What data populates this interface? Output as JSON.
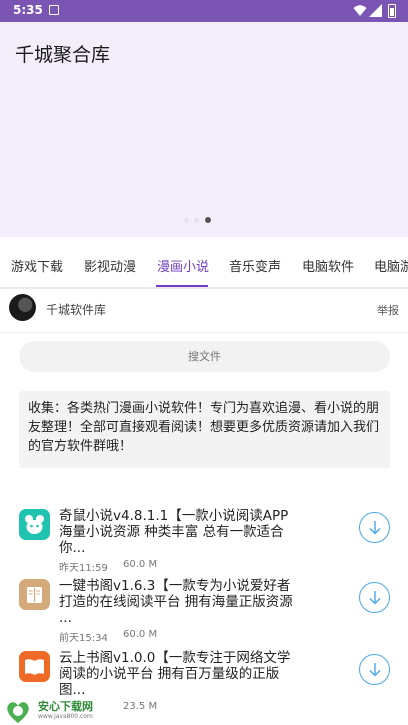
{
  "status_bar": {
    "time": "5:35"
  },
  "header": {
    "title": "千城聚合库"
  },
  "tabs": [
    {
      "label": "游戏下载"
    },
    {
      "label": "影视动漫"
    },
    {
      "label": "漫画小说"
    },
    {
      "label": "音乐变声"
    },
    {
      "label": "电脑软件"
    },
    {
      "label": "电脑游"
    }
  ],
  "active_tab": "漫画小说",
  "author": {
    "name": "千城软件库",
    "report_label": "举报"
  },
  "search": {
    "placeholder": "搜文件"
  },
  "description": "收集：各类热门漫画小说软件！专门为喜欢追漫、看小说的朋友整理！全部可直接观看阅读！想要更多优质资源请加入我们的官方软件群哦！",
  "items": [
    {
      "title": "奇鼠小说v4.8.1.1【一款小说阅读APP 海量小说资源 种类丰富 总有一款适合你...",
      "date": "昨天11:59",
      "size": "60.0 M",
      "icon": "mouse-app-icon",
      "icon_color": "#1fc3b0"
    },
    {
      "title": "一键书阁v1.6.3【一款专为小说爱好者打造的在线阅读平台 拥有海量正版资源 ...",
      "date": "前天15:34",
      "size": "60.0 M",
      "icon": "book-app-icon",
      "icon_color": "#d4aa7a"
    },
    {
      "title": "云上书阁v1.0.0【一款专注于网络文学阅读的小说平台 拥有百万量级的正版图...",
      "date": "",
      "size": "23.5 M",
      "icon": "open-book-app-icon",
      "icon_color": "#ef6a26"
    }
  ],
  "accent_color": "#6f3fc2",
  "watermark": {
    "name": "安心下载网",
    "url": "www.java800.com"
  }
}
